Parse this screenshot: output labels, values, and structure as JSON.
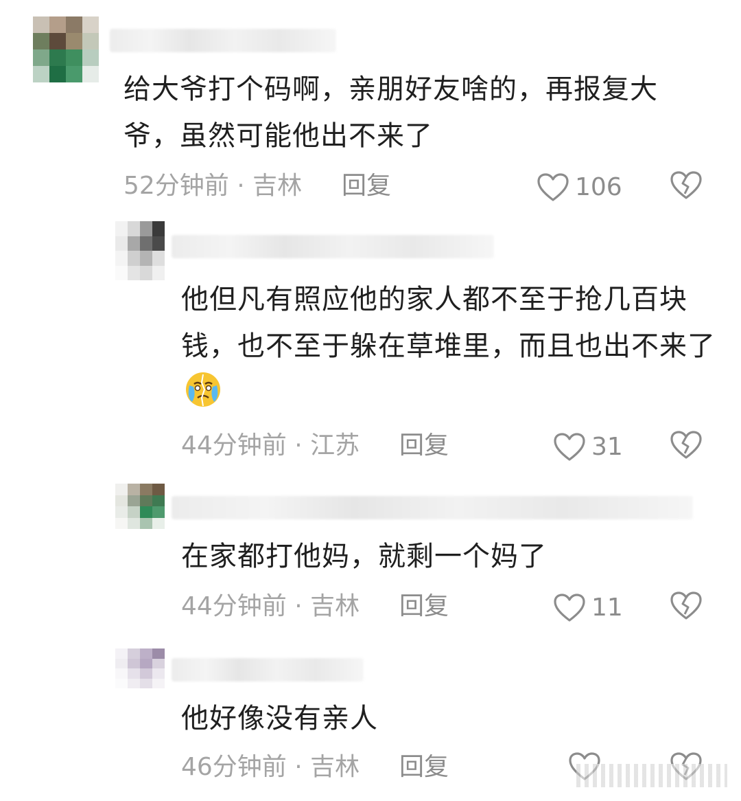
{
  "comments": [
    {
      "text": "给大爷打个码啊，亲朋好友啥的，再报复大爷，虽然可能他出不来了",
      "time": "52分钟前",
      "location": "吉林",
      "reply_label": "回复",
      "likes": "106"
    },
    {
      "text": "他但凡有照应他的家人都不至于抢几百块钱，也不至于躲在草堆里，而且也出不来了",
      "emoji": "crying-face-emoji",
      "time": "44分钟前",
      "location": "江苏",
      "reply_label": "回复",
      "likes": "31"
    },
    {
      "text": "在家都打他妈，就剩一个妈了",
      "time": "44分钟前",
      "location": "吉林",
      "reply_label": "回复",
      "likes": "11"
    },
    {
      "text": "他好像没有亲人",
      "time": "46分钟前",
      "location": "吉林",
      "reply_label": "回复",
      "likes": ""
    }
  ],
  "separator": " · ",
  "icons": {
    "like": "heart-outline-icon",
    "dislike": "broken-heart-icon"
  },
  "colors": {
    "text": "#1f1f1f",
    "meta": "#a4a4a4",
    "icon": "#8c8c8c"
  }
}
